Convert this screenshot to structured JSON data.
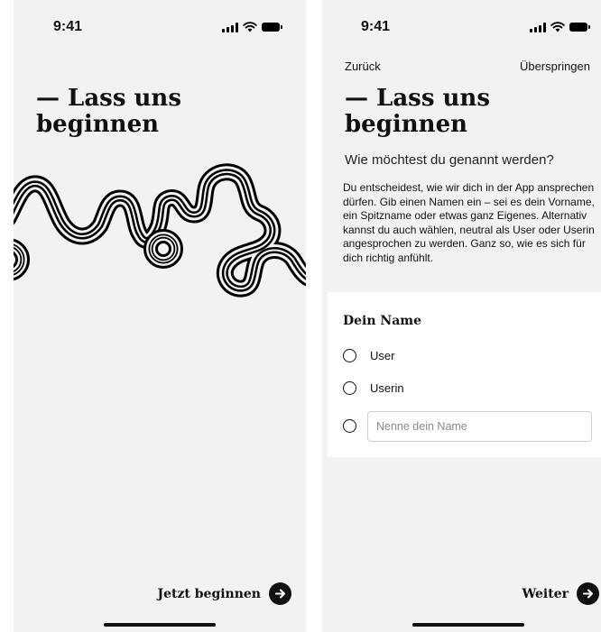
{
  "status_bar": {
    "time": "9:41"
  },
  "onboarding_intro": {
    "headline_line1": "— Lass uns",
    "headline_line2": "beginnen",
    "start_label": "Jetzt beginnen"
  },
  "name_step": {
    "back_label": "Zurück",
    "skip_label": "Überspringen",
    "headline_line1": "— Lass uns",
    "headline_line2": "beginnen",
    "question": "Wie möchtest du genannt werden?",
    "description": "Du entscheidest, wie wir dich in der App ansprechen dürfen. Gib einen Namen ein – sei es dein Vorname, ein Spitzname oder etwas ganz Eigenes. Alternativ kannst du auch wählen, neutral als User oder Userin angesprochen zu werden. Ganz so, wie es sich für dich richtig anfühlt.",
    "card_title": "Dein Name",
    "options": [
      {
        "label": "User"
      },
      {
        "label": "Userin"
      }
    ],
    "name_placeholder": "Nenne dein Name",
    "next_label": "Weiter"
  },
  "icons": {
    "signal": "cellular-signal-icon",
    "wifi": "wifi-icon",
    "battery": "battery-icon",
    "arrow": "arrow-right-icon"
  },
  "colors": {
    "screen_background": "#f2f2f2",
    "card_background": "#ffffff",
    "primary": "#111111"
  }
}
